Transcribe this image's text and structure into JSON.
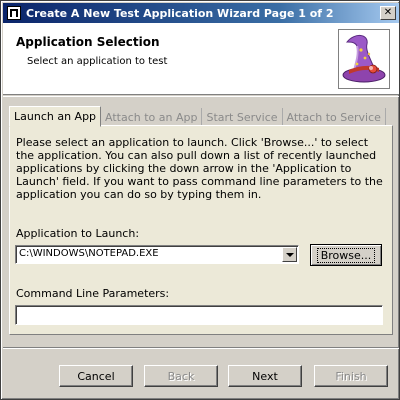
{
  "window": {
    "title": "Create A New Test Application Wizard Page 1 of 2",
    "close_glyph": "✕"
  },
  "header": {
    "title": "Application Selection",
    "subtitle": "Select an application to test",
    "image_icon": "wizard-hat-icon"
  },
  "tabs": [
    {
      "label": "Launch an App",
      "active": true
    },
    {
      "label": "Attach to an App",
      "active": false
    },
    {
      "label": "Start Service",
      "active": false
    },
    {
      "label": "Attach to Service",
      "active": false
    }
  ],
  "launch": {
    "description": "Please select an application to launch.  Click 'Browse...' to select the application.  You can also pull down a list of recently launched applications by clicking the down arrow in the 'Application to Launch' field.  If you want to pass command line parameters to the application you can do so by typing them in.",
    "app_label": "Application to Launch:",
    "app_value": "C:\\WINDOWS\\NOTEPAD.EXE",
    "browse_label": "Browse...",
    "cmd_label": "Command Line Parameters:",
    "cmd_value": ""
  },
  "footer": {
    "cancel_label": "Cancel",
    "back_label": "Back",
    "next_label": "Next",
    "finish_label": "Finish"
  }
}
